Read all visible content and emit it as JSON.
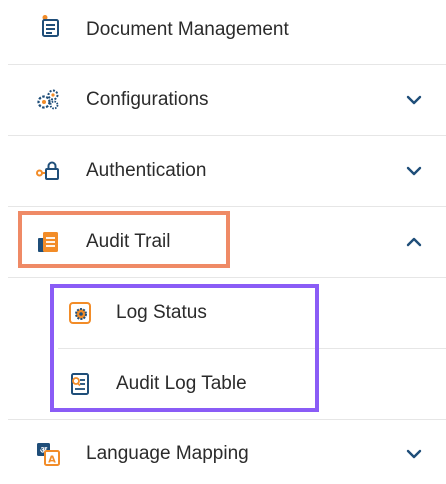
{
  "menu": {
    "items": [
      {
        "label": "Document Management",
        "icon": "document-icon",
        "expanded": null
      },
      {
        "label": "Configurations",
        "icon": "gears-icon",
        "expanded": false
      },
      {
        "label": "Authentication",
        "icon": "key-icon",
        "expanded": false
      },
      {
        "label": "Audit Trail",
        "icon": "audit-trail-icon",
        "expanded": true
      },
      {
        "label": "Language Mapping",
        "icon": "language-icon",
        "expanded": false
      }
    ],
    "audit_trail_children": [
      {
        "label": "Log Status",
        "icon": "log-status-icon"
      },
      {
        "label": "Audit Log Table",
        "icon": "audit-log-table-icon"
      }
    ]
  },
  "colors": {
    "highlight_orange": "#ef8a66",
    "highlight_purple": "#8a5cf6",
    "chevron": "#1f4e79",
    "icon_orange": "#f28c28",
    "icon_blue": "#1f4e79"
  }
}
